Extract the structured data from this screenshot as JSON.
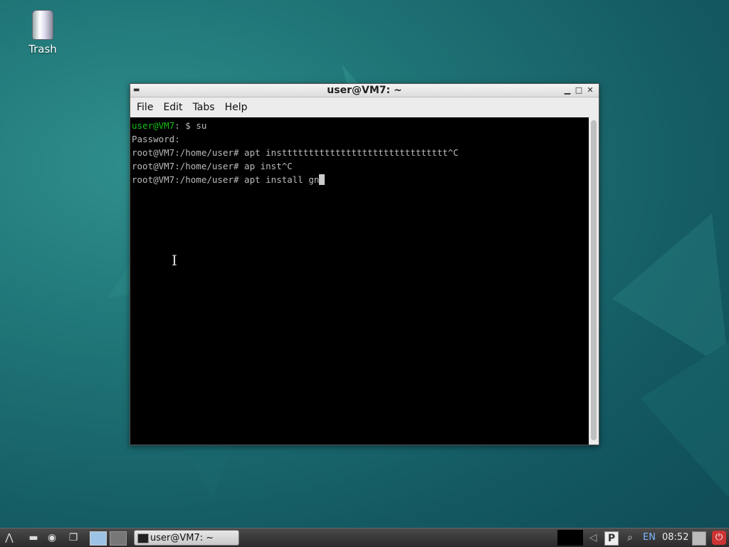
{
  "desktop": {
    "trash_label": "Trash"
  },
  "window": {
    "title": "user@VM7: ~",
    "menu": [
      "File",
      "Edit",
      "Tabs",
      "Help"
    ]
  },
  "terminal": {
    "lines": [
      {
        "prompt_user": "user@VM7",
        "rest": ": $ su"
      },
      {
        "text": "Password:"
      },
      {
        "text": "root@VM7:/home/user# apt insttttttttttttttttttttttttttttttt^C"
      },
      {
        "text": "root@VM7:/home/user# ap inst^C"
      },
      {
        "text": "root@VM7:/home/user# apt install gn"
      }
    ]
  },
  "taskbar": {
    "task_label": "user@VM7: ~",
    "lang": "EN",
    "clock": "08:52"
  },
  "colors": {
    "prompt_green": "#17c117",
    "terminal_bg": "#000000"
  }
}
